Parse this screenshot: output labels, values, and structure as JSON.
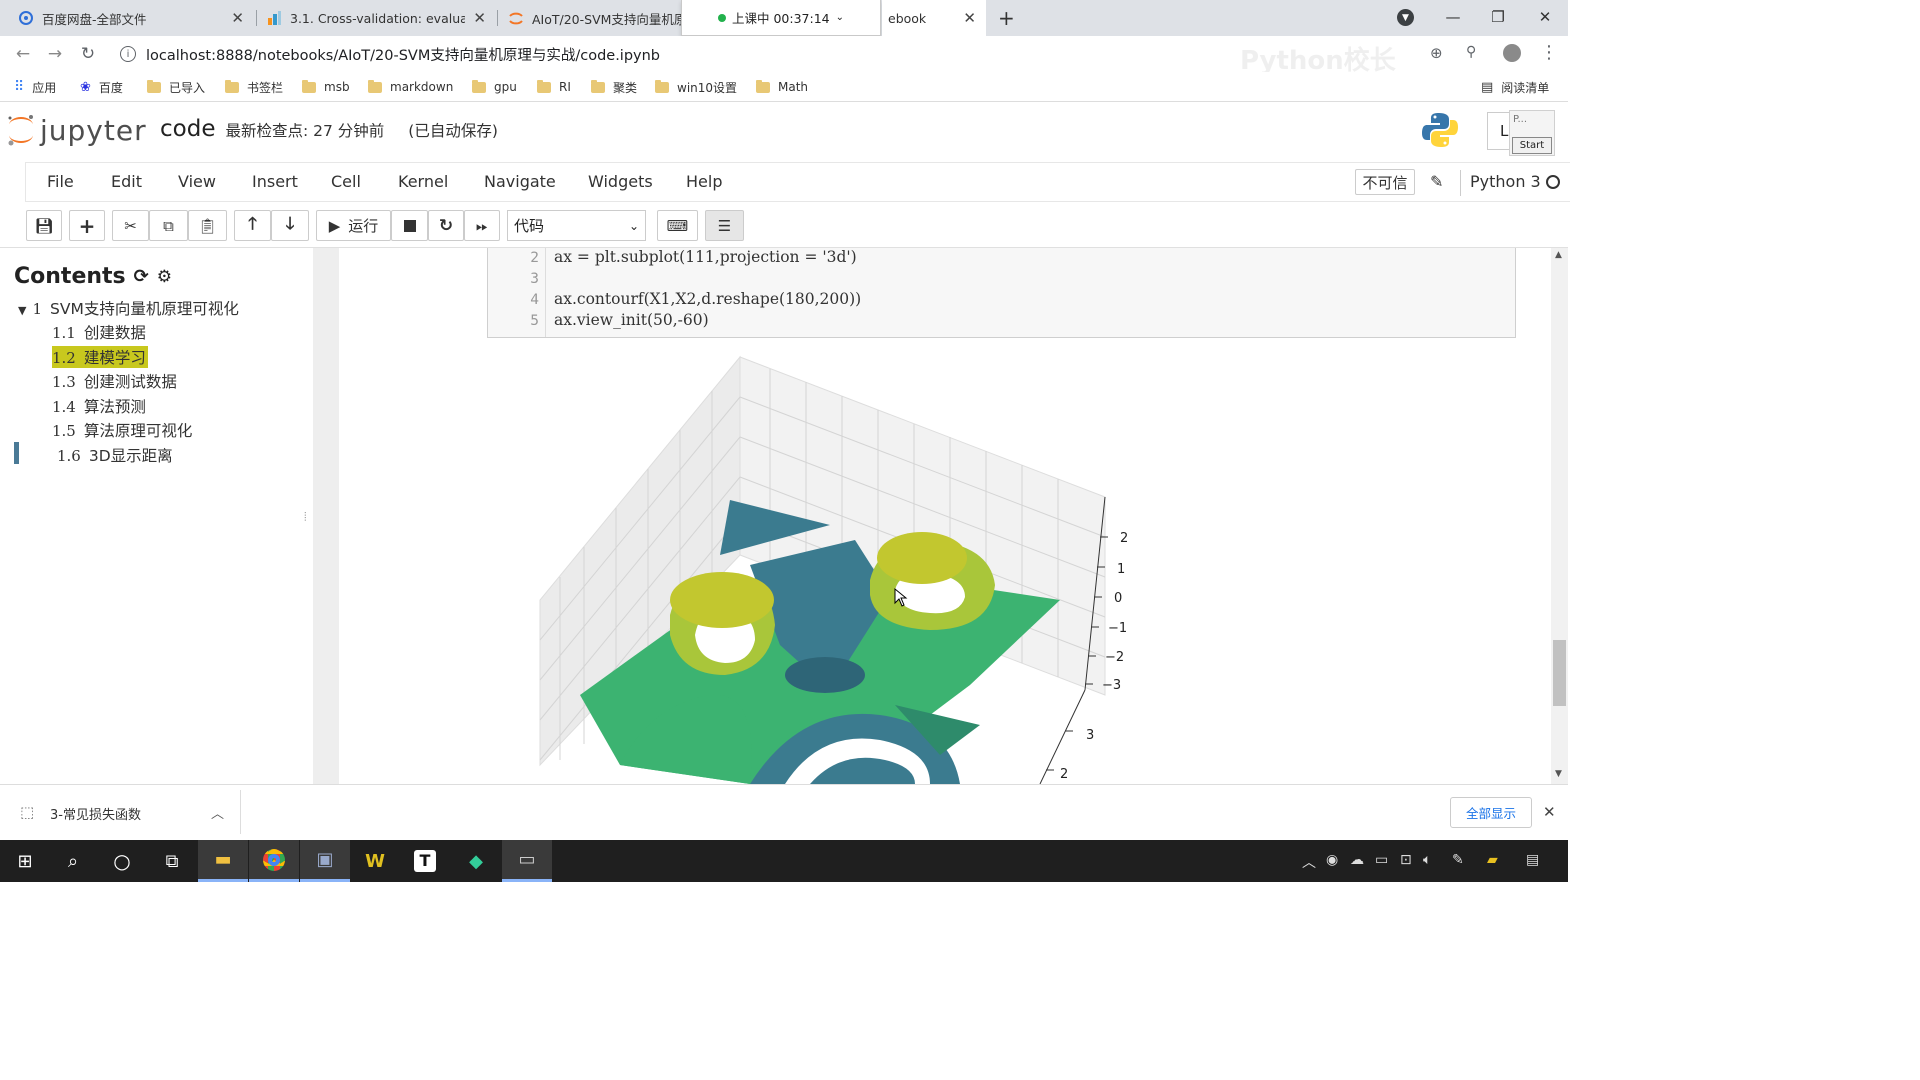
{
  "browser": {
    "tabs": [
      {
        "title": "百度网盘-全部文件",
        "favicon": "baidu-pan-icon"
      },
      {
        "title": "3.1. Cross-validation: evaluati",
        "favicon": "scikit-learn-icon"
      },
      {
        "title": "AIoT/20-SVM支持向量机原",
        "favicon": "jupyter-icon"
      },
      {
        "title": "ebook",
        "favicon": ""
      }
    ],
    "recording_badge": "上课中 00:37:14",
    "url": "localhost:8888/notebooks/AIoT/20-SVM支持向量机原理与实战/code.ipynb",
    "bookmarks": [
      "应用",
      "百度",
      "已导入",
      "书签栏",
      "msb",
      "markdown",
      "gpu",
      "RI",
      "聚类",
      "win10设置",
      "Math"
    ],
    "reading_list": "阅读清单"
  },
  "jupyter": {
    "logo_text": "jupyter",
    "notebook_name": "code",
    "checkpoint": "最新检查点: 27 分钟前",
    "autosave": "(已自动保存)",
    "menu": [
      "File",
      "Edit",
      "View",
      "Insert",
      "Cell",
      "Kernel",
      "Navigate",
      "Widgets",
      "Help"
    ],
    "trusted": "不可信",
    "kernel": "Python 3",
    "run_label": "运行",
    "cell_type": "代码",
    "logout_initial": "L",
    "popup_start": "Start",
    "popup_text": "P..."
  },
  "toc": {
    "title": "Contents",
    "items": [
      {
        "num": "1",
        "label": "SVM支持向量机原理可视化",
        "level": 1,
        "active": false
      },
      {
        "num": "1.1",
        "label": "创建数据",
        "level": 2,
        "active": false
      },
      {
        "num": "1.2",
        "label": "建模学习",
        "level": 2,
        "active": true
      },
      {
        "num": "1.3",
        "label": "创建测试数据",
        "level": 2,
        "active": false
      },
      {
        "num": "1.4",
        "label": "算法预测",
        "level": 2,
        "active": false
      },
      {
        "num": "1.5",
        "label": "算法原理可视化",
        "level": 2,
        "active": false
      },
      {
        "num": "1.6",
        "label": "3D显示距离",
        "level": 2,
        "active": false
      }
    ]
  },
  "cell": {
    "lines": [
      {
        "n": "2",
        "text": "ax = plt.subplot(111,projection = '3d')"
      },
      {
        "n": "3",
        "text": ""
      },
      {
        "n": "4",
        "text": "ax.contourf(X1,X2,d.reshape(180,200))"
      },
      {
        "n": "5",
        "text": "ax.view_init(50,-60)"
      }
    ]
  },
  "plot": {
    "z_ticks": [
      "2",
      "1",
      "0",
      "−1",
      "−2",
      "−3"
    ],
    "y_ticks": [
      "3",
      "2"
    ],
    "colors": {
      "dark": "#3b7b8f",
      "green": "#3cb371",
      "yellow": "#c2c72f"
    }
  },
  "download": {
    "file": "3-常见损失函数",
    "show_all": "全部显示"
  },
  "watermark": "Python校长"
}
